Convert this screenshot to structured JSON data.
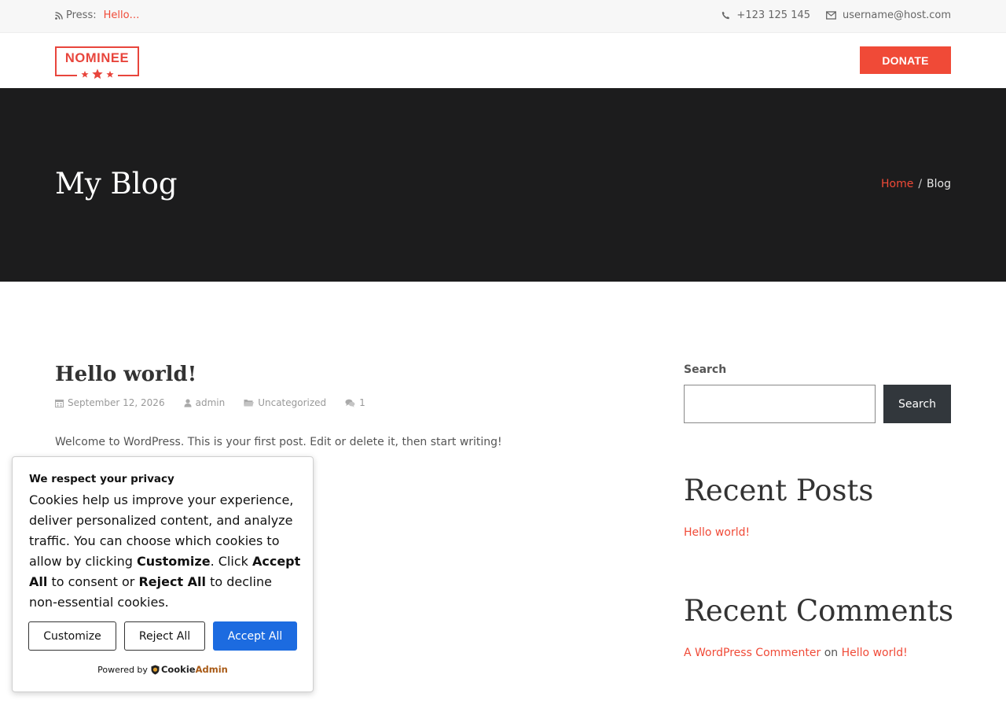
{
  "topbar": {
    "press_label": "Press:",
    "press_link": "Hello…",
    "phone": "+123 125 145",
    "email": "username@host.com"
  },
  "header": {
    "logo_text": "NOMINEE",
    "donate_label": "DONATE"
  },
  "hero": {
    "title": "My Blog",
    "breadcrumb_home": "Home",
    "breadcrumb_sep": "/",
    "breadcrumb_current": "Blog"
  },
  "post": {
    "title": "Hello world!",
    "date": "September 12, 2026",
    "author": "admin",
    "category": "Uncategorized",
    "comments": "1",
    "excerpt": "Welcome to WordPress. This is your first post. Edit or delete it, then start writing!"
  },
  "sidebar": {
    "search_label": "Search",
    "search_value": "",
    "search_button": "Search",
    "recent_posts_title": "Recent Posts",
    "recent_post_link": "Hello world!",
    "recent_comments_title": "Recent Comments",
    "comment_author": "A WordPress Commenter",
    "comment_on": "on",
    "comment_post": "Hello world!"
  },
  "cookie": {
    "title": "We respect your privacy",
    "text_1": "Cookies help us improve your experience, deliver personalized content, and analyze traffic. You can choose which cookies to allow by clicking ",
    "bold_customize": "Customize",
    "text_2": ". Click ",
    "bold_accept": "Accept All",
    "text_3": " to consent or ",
    "bold_reject": "Reject All",
    "text_4": " to decline non-essential cookies.",
    "customize_button": "Customize",
    "reject_button": "Reject All",
    "accept_button": "Accept All",
    "powered_by": "Powered by",
    "brand_part1": "Cookie",
    "brand_part2": "Admin"
  },
  "colors": {
    "accent": "#f04a37",
    "hero_bg": "#1c1c1d",
    "accept_blue": "#1c6be0",
    "search_button_bg": "#32373c"
  }
}
